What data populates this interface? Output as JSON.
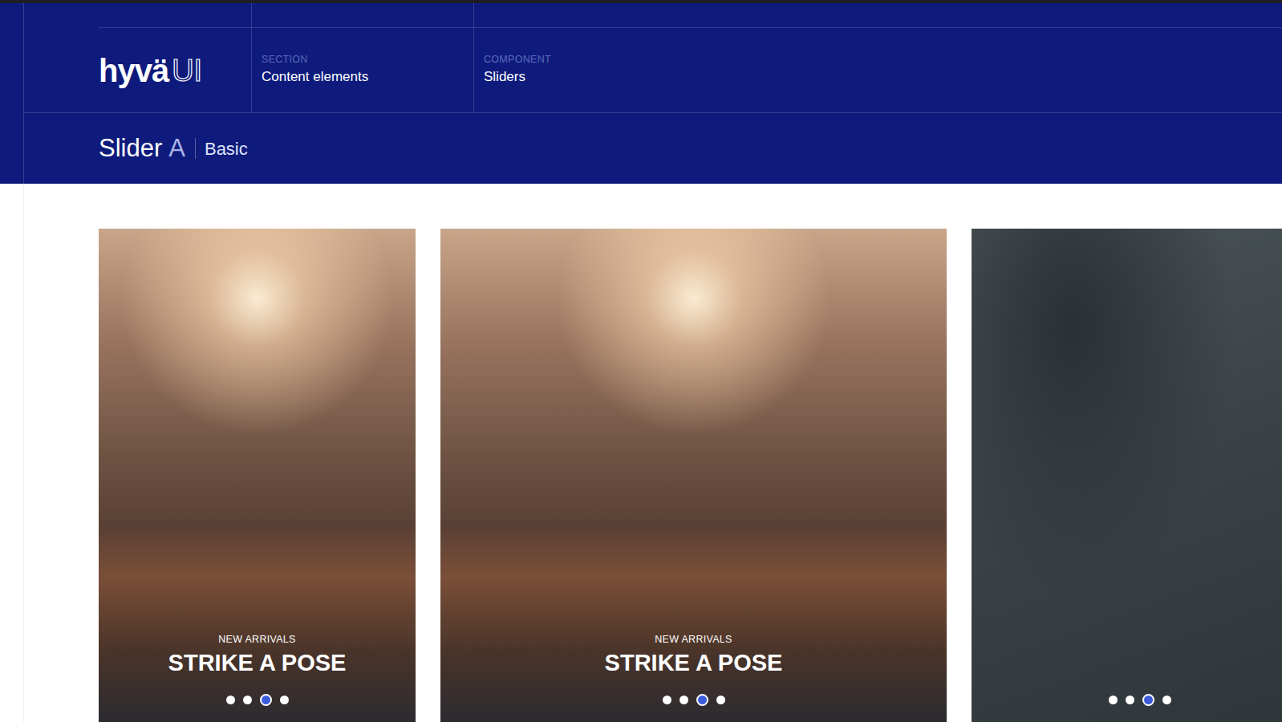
{
  "logo": {
    "brand": "hyvä",
    "suffix": "UI"
  },
  "breadcrumb": [
    {
      "label": "SECTION",
      "value": "Content elements"
    },
    {
      "label": "COMPONENT",
      "value": "Sliders"
    }
  ],
  "page_title": {
    "name": "Slider",
    "variant": "A",
    "subtitle": "Basic"
  },
  "slides": [
    {
      "eyebrow": "NEW ARRIVALS",
      "heading": "STRIKE A POSE",
      "kind": "yoga",
      "dots": [
        {
          "selected": false
        },
        {
          "selected": false
        },
        {
          "selected": true
        },
        {
          "selected": false
        }
      ]
    },
    {
      "eyebrow": "NEW ARRIVALS",
      "heading": "STRIKE A POSE",
      "kind": "yoga",
      "dots": [
        {
          "selected": false
        },
        {
          "selected": false
        },
        {
          "selected": true
        },
        {
          "selected": false
        }
      ]
    },
    {
      "kind": "gym",
      "dots": [
        {
          "selected": false
        },
        {
          "selected": false
        },
        {
          "selected": true
        },
        {
          "selected": false
        }
      ]
    }
  ]
}
